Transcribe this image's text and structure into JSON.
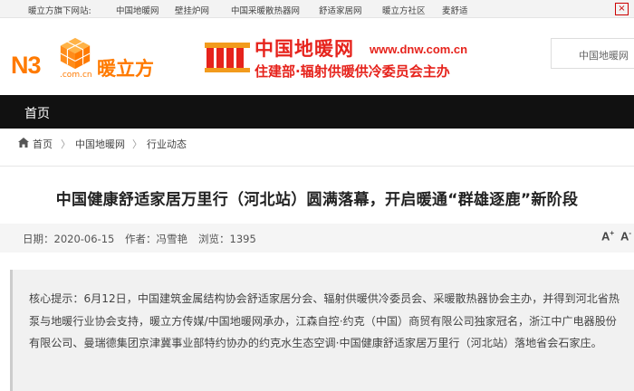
{
  "topbar": {
    "lead": "暖立方旗下网站:",
    "links": [
      "中国地暖网",
      "壁挂炉网",
      "中国采暖散热器网",
      "舒适家居网",
      "暖立方社区",
      "麦舒适"
    ],
    "close": "×"
  },
  "header": {
    "n3_logo_text": "N3",
    "n3_dotcom": ".com.cn",
    "brand_name": "暖立方",
    "dnw_title": "中国地暖网",
    "dnw_url": "www.dnw.com.cn",
    "dnw_subtitle": "住建部·辐射供暖供冷委员会主办",
    "search_placeholder": "中国地暖网"
  },
  "nav": {
    "home": "首页"
  },
  "breadcrumb": [
    "首页",
    "中国地暖网",
    "行业动态"
  ],
  "article": {
    "title": "中国健康舒适家居万里行（河北站）圆满落幕，开启暖通“群雄逐鹿”新阶段",
    "date_label": "日期：2020-06-15",
    "author_label": "作者：冯雪艳",
    "views_label": "浏览：1395",
    "font_larger": "A",
    "font_smaller": "A",
    "summary": "核心提示：6月12日，中国建筑金属结构协会舒适家居分会、辐射供暖供冷委员会、采暖散热器协会主办，并得到河北省热泵与地暖行业协会支持，暖立方传媒/中国地暖网承办，江森自控·约克（中国）商贸有限公司独家冠名，浙江中广电器股份有限公司、曼瑞德集团京津冀事业部特约协办的约克水生态空调·中国健康舒适家居万里行（河北站）落地省会石家庄。"
  },
  "colors": {
    "orange": "#ff7a00",
    "red": "#e6231c",
    "nav": "#111111"
  }
}
